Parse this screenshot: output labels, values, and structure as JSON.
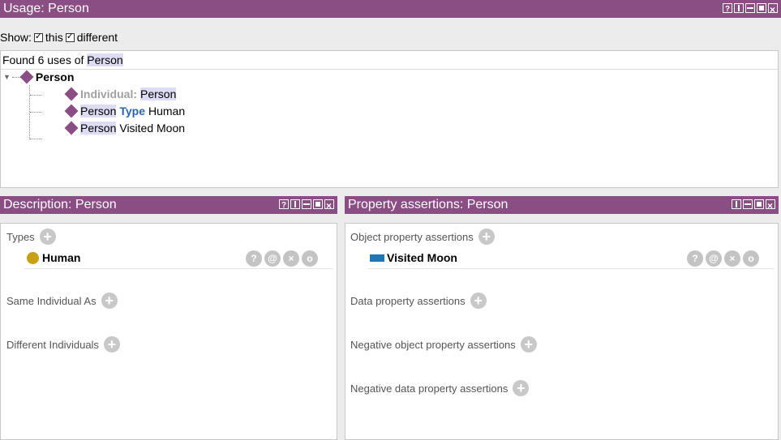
{
  "usage": {
    "title": "Usage: Person",
    "show_label": "Show:",
    "this_label": "this",
    "different_label": "different",
    "found_prefix": "Found 6 uses of",
    "found_entity": "Person",
    "root": "Person",
    "items": [
      {
        "prefix": "Individual:",
        "subject": "Person",
        "keyword": "",
        "object": ""
      },
      {
        "prefix": "",
        "subject": "Person",
        "keyword": "Type",
        "object": "Human"
      },
      {
        "prefix": "",
        "subject": "Person",
        "keyword": "",
        "object": "Visited Moon"
      }
    ]
  },
  "description": {
    "title": "Description: Person",
    "types_label": "Types",
    "type_value": "Human",
    "same_label": "Same Individual As",
    "different_label": "Different Individuals"
  },
  "assertions": {
    "title": "Property assertions: Person",
    "object_label": "Object property assertions",
    "object_prop": "Visited",
    "object_value": "Moon",
    "data_label": "Data property assertions",
    "neg_object_label": "Negative object property assertions",
    "neg_data_label": "Negative data property assertions"
  },
  "row_buttons": [
    "?",
    "@",
    "×",
    "o"
  ],
  "colors": {
    "titlebar": "#8a4e84",
    "class_icon": "#c9a012",
    "objprop_icon": "#1f75b8",
    "individual_icon": "#8a4e84"
  }
}
